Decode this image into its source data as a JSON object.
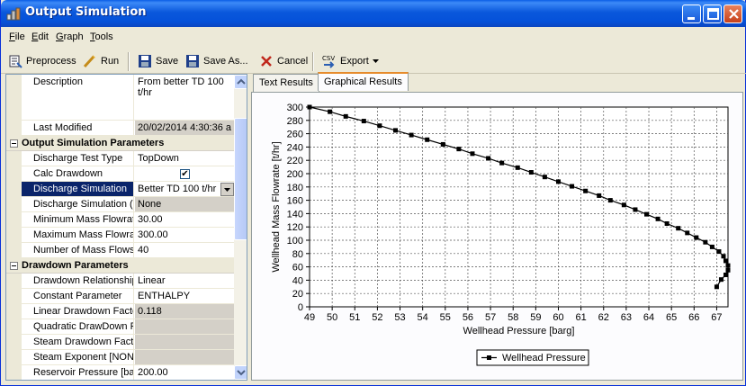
{
  "window": {
    "title": "Output Simulation"
  },
  "menu": [
    "File",
    "Edit",
    "Graph",
    "Tools"
  ],
  "toolbar": {
    "preprocess": "Preprocess",
    "run": "Run",
    "save": "Save",
    "save_as": "Save As...",
    "cancel": "Cancel",
    "export": "Export",
    "csv_label": "CSV"
  },
  "properties": {
    "description_label": "Description",
    "description_value": "From better TD 100",
    "description_value2": "t/hr",
    "last_modified_label": "Last Modified",
    "last_modified_value": "20/02/2014 4:30:36 a",
    "cat1": "Output Simulation Parameters",
    "discharge_test_type_label": "Discharge Test Type",
    "discharge_test_type_value": "TopDown",
    "calc_drawdown_label": "Calc Drawdown",
    "calc_drawdown_value": "✔",
    "discharge_simulation_label": "Discharge Simulation",
    "discharge_simulation_value": "Better TD 100 t/hr",
    "discharge_simulation_c_label": "Discharge Simulation (C",
    "discharge_simulation_c_value": "None",
    "min_mass_label": "Minimum Mass Flowrate",
    "min_mass_value": "30.00",
    "max_mass_label": "Maximum Mass Flowrat",
    "max_mass_value": "300.00",
    "num_mass_label": "Number of Mass Flows",
    "num_mass_value": "40",
    "cat2": "Drawdown Parameters",
    "drawdown_rel_label": "Drawdown Relationship",
    "drawdown_rel_value": "Linear",
    "constant_param_label": "Constant Parameter",
    "constant_param_value": "ENTHALPY",
    "linear_drawdown_label": "Linear Drawdown Facto",
    "linear_drawdown_value": "0.118",
    "quadratic_drawdown_label": "Quadratic DrawDown F",
    "quadratic_drawdown_value": "",
    "steam_drawdown_label": "Steam Drawdown Facto",
    "steam_drawdown_value": "",
    "steam_exponent_label": "Steam Exponent [NONI",
    "steam_exponent_value": "",
    "reservoir_pressure_label": "Reservoir Pressure [ba",
    "reservoir_pressure_value": "200.00"
  },
  "tabs": {
    "text_results": "Text Results",
    "graphical_results": "Graphical Results"
  },
  "chart_data": {
    "type": "line",
    "title": "",
    "xlabel": "Wellhead Pressure [barg]",
    "ylabel": "Wellhead Mass Flowrate [t/hr]",
    "xlim": [
      49,
      67.5
    ],
    "ylim": [
      0,
      300
    ],
    "xticks": [
      49,
      50,
      51,
      52,
      53,
      54,
      55,
      56,
      57,
      58,
      59,
      60,
      61,
      62,
      63,
      64,
      65,
      66,
      67
    ],
    "yticks": [
      0,
      20,
      40,
      60,
      80,
      100,
      120,
      140,
      160,
      180,
      200,
      220,
      240,
      260,
      280,
      300
    ],
    "grid": true,
    "legend_position": "bottom",
    "series": [
      {
        "name": "Wellhead Pressure",
        "color": "#000000",
        "x": [
          49.0,
          49.9,
          50.6,
          51.4,
          52.1,
          52.8,
          53.5,
          54.2,
          54.9,
          55.6,
          56.2,
          56.9,
          57.5,
          58.2,
          58.8,
          59.4,
          60.0,
          60.6,
          61.2,
          61.8,
          62.3,
          62.9,
          63.4,
          63.9,
          64.4,
          64.8,
          65.3,
          65.7,
          66.1,
          66.5,
          66.8,
          67.1,
          67.3,
          67.4,
          67.5,
          67.5,
          67.4,
          67.2,
          67.0
        ],
        "y": [
          300,
          293,
          286,
          279,
          272,
          265,
          258,
          251,
          244,
          237,
          230,
          223,
          216,
          209,
          202,
          195,
          188,
          181,
          174,
          167,
          160,
          153,
          146,
          139,
          132,
          125,
          118,
          111,
          104,
          97,
          90,
          83,
          76,
          69,
          62,
          55,
          48,
          41,
          30
        ]
      }
    ]
  }
}
